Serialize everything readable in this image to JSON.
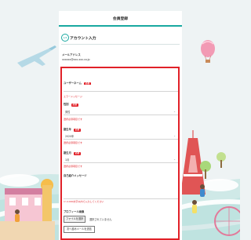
{
  "form": {
    "title": "会員登録",
    "step_number": "1/4",
    "section_title": "アカウント入力",
    "email": {
      "label": "メールアドレス",
      "value": "xxxxxx@xxx-xxx.co.jp"
    },
    "required_badge": "必須",
    "username": {
      "label": "ユーザーネーム",
      "error": "エラーメッセージ"
    },
    "gender": {
      "label": "性別",
      "value": "男性",
      "error": "選択必須項目です"
    },
    "birth_year": {
      "label": "誕生年",
      "value": "2020年",
      "error": "選択必須項目です"
    },
    "birth_month": {
      "label": "誕生月",
      "value": "1月",
      "error": "選択必須項目です"
    },
    "message": {
      "label": "自己紹介メッセージ",
      "error": "1〜1000文字以内で入力してください"
    },
    "profile_image": {
      "label": "プロフィール画像",
      "button": "ファイルを選択",
      "status": "選択されていません"
    },
    "submit": "次へ進みメールを送信",
    "chevron": "⌄"
  },
  "background": {
    "description_icons": [
      "airplane-icon",
      "balloon-icon",
      "tower-icon",
      "ferris-wheel-icon"
    ]
  },
  "colors": {
    "accent": "#18a8a0",
    "error": "#e12128",
    "sky": "#eef3f4"
  }
}
